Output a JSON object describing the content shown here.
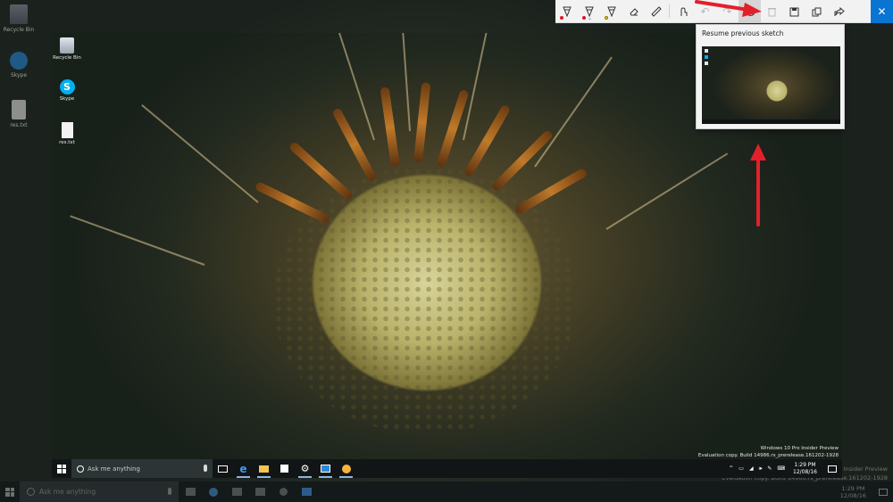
{
  "outer_desktop": {
    "icons": [
      {
        "label": "Recycle Bin"
      },
      {
        "label": "Skype"
      },
      {
        "label": "res.txt"
      }
    ],
    "watermark_line1": "Windows 10 Pro Insider Preview",
    "watermark_line2": "Evaluation copy. Build 14986.rs_prerelease.161202-1928"
  },
  "outer_taskbar": {
    "search_placeholder": "Ask me anything",
    "clock_time": "1:29 PM",
    "clock_date": "12/08/16"
  },
  "inner_desktop": {
    "icons": [
      {
        "label": "Recycle Bin"
      },
      {
        "label": "Skype"
      },
      {
        "label": "res.txt"
      }
    ],
    "watermark_line1": "Windows 10 Pro Insider Preview",
    "watermark_line2": "Evaluation copy. Build 14986.rs_prerelease.161202-1928"
  },
  "inner_taskbar": {
    "search_placeholder": "Ask me anything",
    "clock_time": "1:29 PM",
    "clock_date": "12/08/16"
  },
  "ink_toolbar": {
    "tools": [
      {
        "icon": "ballpoint-pen-icon",
        "color": "#e81123"
      },
      {
        "icon": "pencil-icon",
        "color": "#e81123"
      },
      {
        "icon": "highlighter-icon",
        "color": "#ffd200"
      },
      {
        "icon": "eraser-icon"
      },
      {
        "icon": "ruler-icon"
      },
      {
        "icon": "touch-writing-icon"
      },
      {
        "icon": "undo-icon"
      },
      {
        "icon": "redo-icon"
      },
      {
        "icon": "resume-history-icon"
      },
      {
        "icon": "delete-icon"
      },
      {
        "icon": "save-icon"
      },
      {
        "icon": "copy-icon"
      },
      {
        "icon": "share-icon"
      },
      {
        "icon": "close-icon"
      }
    ]
  },
  "resume_flyout": {
    "title": "Resume previous sketch"
  },
  "colors": {
    "accent": "#0a74d2",
    "annotation_red": "#e3202a"
  }
}
